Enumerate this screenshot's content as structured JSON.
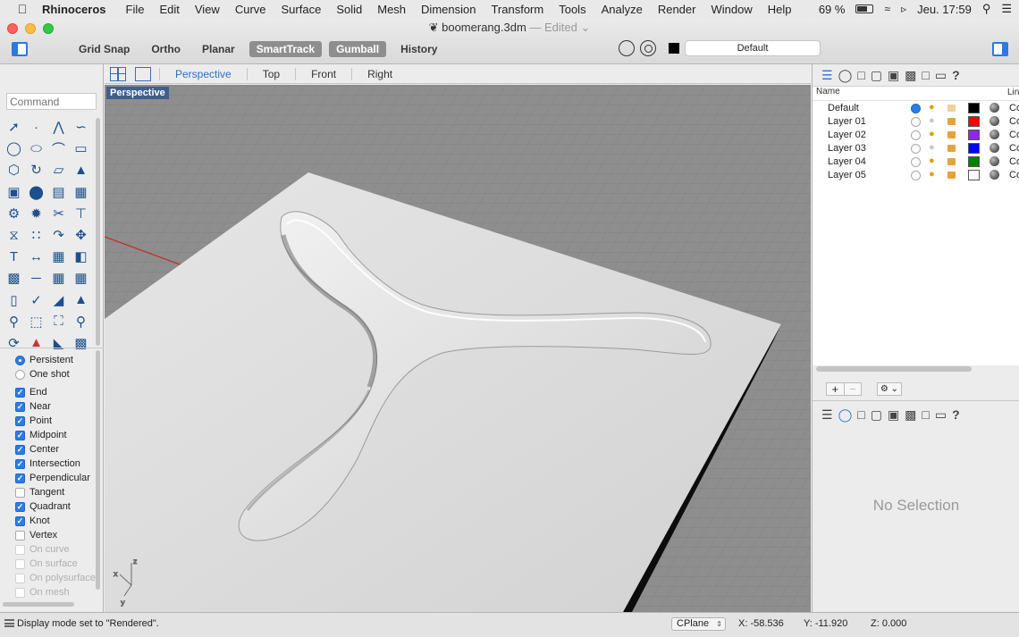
{
  "menubar": {
    "app_name": "Rhinoceros",
    "items": [
      "File",
      "Edit",
      "View",
      "Curve",
      "Surface",
      "Solid",
      "Mesh",
      "Dimension",
      "Transform",
      "Tools",
      "Analyze",
      "Render",
      "Window",
      "Help"
    ],
    "battery": "69 %",
    "battery_level": 0.69,
    "clock": "Jeu. 17:59"
  },
  "window": {
    "file_name": "boomerang.3dm",
    "edited_suffix": " — Edited"
  },
  "toolbar": {
    "modes": [
      {
        "label": "Grid Snap",
        "on": false
      },
      {
        "label": "Ortho",
        "on": false
      },
      {
        "label": "Planar",
        "on": false
      },
      {
        "label": "SmartTrack",
        "on": true
      },
      {
        "label": "Gumball",
        "on": true
      },
      {
        "label": "History",
        "on": false
      }
    ],
    "current_layer": "Default",
    "current_color": "#000000"
  },
  "command": {
    "placeholder": "Command"
  },
  "osnaps": {
    "persistent_label": "Persistent",
    "oneshot_label": "One shot",
    "items": [
      {
        "label": "End",
        "checked": true,
        "enabled": true
      },
      {
        "label": "Near",
        "checked": true,
        "enabled": true
      },
      {
        "label": "Point",
        "checked": true,
        "enabled": true
      },
      {
        "label": "Midpoint",
        "checked": true,
        "enabled": true
      },
      {
        "label": "Center",
        "checked": true,
        "enabled": true
      },
      {
        "label": "Intersection",
        "checked": true,
        "enabled": true
      },
      {
        "label": "Perpendicular",
        "checked": true,
        "enabled": true
      },
      {
        "label": "Tangent",
        "checked": false,
        "enabled": true
      },
      {
        "label": "Quadrant",
        "checked": true,
        "enabled": true
      },
      {
        "label": "Knot",
        "checked": true,
        "enabled": true
      },
      {
        "label": "Vertex",
        "checked": false,
        "enabled": true
      },
      {
        "label": "On curve",
        "checked": false,
        "enabled": false
      },
      {
        "label": "On surface",
        "checked": false,
        "enabled": false
      },
      {
        "label": "On polysurface",
        "checked": false,
        "enabled": false
      },
      {
        "label": "On mesh",
        "checked": false,
        "enabled": false
      }
    ]
  },
  "viewport_tabs": [
    "Perspective",
    "Top",
    "Front",
    "Right"
  ],
  "active_view": "Perspective",
  "viewport": {
    "label": "Perspective",
    "axis_labels": {
      "x": "x",
      "y": "y",
      "z": "z"
    }
  },
  "layers": {
    "name_header": "Name",
    "linetype_header": "Lin",
    "rows": [
      {
        "name": "Default",
        "current": true,
        "color": "#000000",
        "light_on": true,
        "lock_faded": true,
        "linetype": "Co"
      },
      {
        "name": "Layer 01",
        "current": false,
        "color": "#ff0000",
        "light_on": false,
        "lock_faded": false,
        "linetype": "Co"
      },
      {
        "name": "Layer 02",
        "current": false,
        "color": "#8a2be2",
        "light_on": true,
        "lock_faded": false,
        "linetype": "Co"
      },
      {
        "name": "Layer 03",
        "current": false,
        "color": "#0000ff",
        "light_on": false,
        "lock_faded": false,
        "linetype": "Co"
      },
      {
        "name": "Layer 04",
        "current": false,
        "color": "#008000",
        "light_on": true,
        "lock_faded": false,
        "linetype": "Co"
      },
      {
        "name": "Layer 05",
        "current": false,
        "color": "#ffffff",
        "light_on": true,
        "lock_faded": false,
        "linetype": "Co"
      }
    ]
  },
  "properties": {
    "empty_message": "No Selection"
  },
  "status": {
    "message": "Display mode set to \"Rendered\".",
    "cplane": "CPlane",
    "x": "X: -58.536",
    "y": "Y: -11.920",
    "z": "Z: 0.000"
  },
  "icons": {
    "apple": "apple-icon",
    "wifi": "wifi-icon",
    "sound": "speaker-icon",
    "search": "search-icon",
    "list": "list-icon",
    "document": "rhino-document-icon"
  }
}
